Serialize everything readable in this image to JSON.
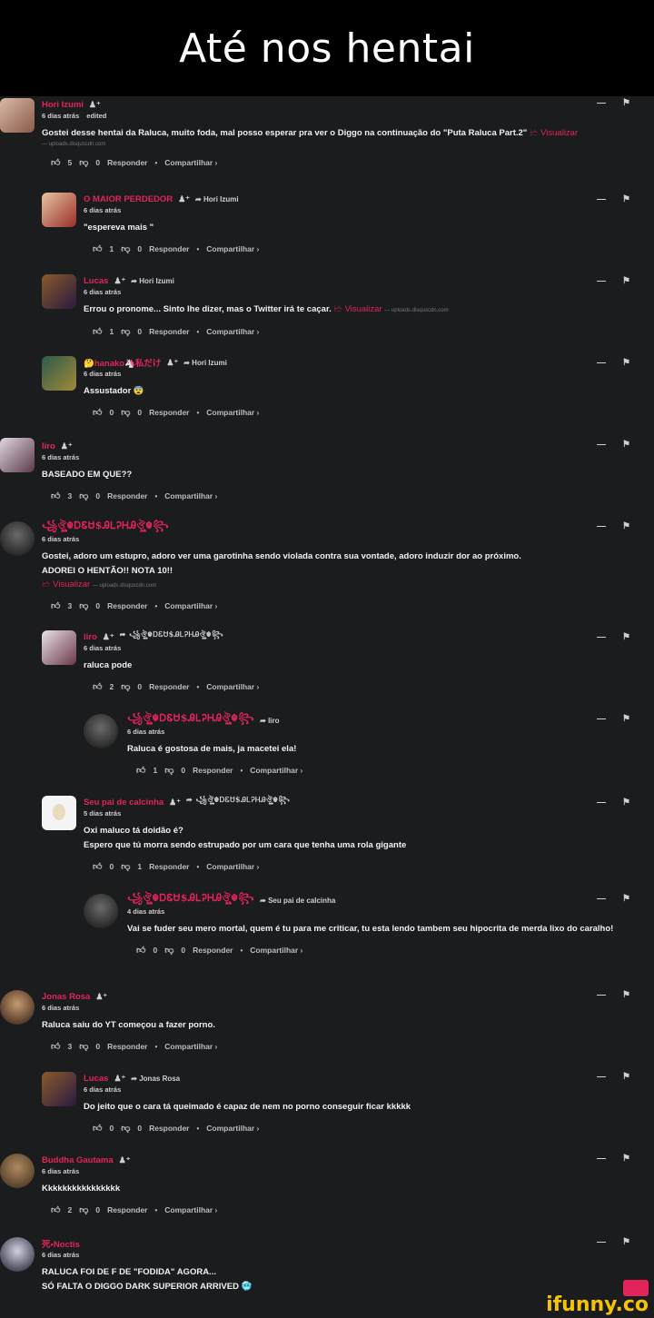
{
  "page": {
    "title": "Até nos hentai"
  },
  "thread": {
    "c1": {
      "author": "Hori Izumi",
      "badge": "♟⁺",
      "time": "6 dias atrás",
      "edited": "edited",
      "text": "Gostei desse hentai da Raluca, muito foda, mal posso esperar pra ver o Diggo na continuação do \"Puta Raluca Part.2\"",
      "visualizar": "🗠 Visualizar",
      "source": "— uploads.disquscdn.com",
      "likes": "5",
      "dislikes": "0",
      "reply": "Responder",
      "share": "Compartilhar ›"
    },
    "c2": {
      "author": "O MAIOR PERDEDOR",
      "badge": "♟⁺",
      "reply_to": "➦ Hori Izumi",
      "time": "6 dias atrás",
      "text": "\"espereva mais \"",
      "likes": "1",
      "dislikes": "0",
      "reply": "Responder",
      "share": "Compartilhar ›"
    },
    "c3": {
      "author": "Lucas",
      "badge": "♟⁺",
      "reply_to": "➦ Hori Izumi",
      "time": "6 dias atrás",
      "text": "Errou o pronome... Sinto lhe dizer, mas o Twitter irá te caçar.",
      "visualizar": "🗠 Visualizar",
      "source": "— uploads.disquscdn.com",
      "likes": "1",
      "dislikes": "0",
      "reply": "Responder",
      "share": "Compartilhar ›"
    },
    "c4": {
      "author": "🤔hanako🦄私だけ",
      "badge": "♟⁺",
      "reply_to": "➦ Hori Izumi",
      "time": "6 dias atrás",
      "text": "Assustador 😨",
      "likes": "0",
      "dislikes": "0",
      "reply": "Responder",
      "share": "Compartilhar ›"
    },
    "c5": {
      "author": "liro",
      "badge": "♟⁺",
      "time": "6 dias atrás",
      "text": "BASEADO EM QUE??",
      "likes": "3",
      "dislikes": "0",
      "reply": "Responder",
      "share": "Compartilhar ›"
    },
    "c6": {
      "author": "꧁ঔৣ☬ᎠᏋᏌ$ᎯᏞᎮᎻᎯঔৣ☬꧂",
      "time": "6 dias atrás",
      "text1": "Gostei, adoro um estupro, adoro ver uma garotinha sendo violada contra sua vontade, adoro induzir dor ao próximo.",
      "text2": "ADOREI O HENTÃO!! NOTA 10!!",
      "visualizar": "🗠 Visualizar",
      "source": "— uploads.disquscdn.com",
      "likes": "3",
      "dislikes": "0",
      "reply": "Responder",
      "share": "Compartilhar ›"
    },
    "c7": {
      "author": "liro",
      "badge": "♟⁺",
      "reply_to": "➦ ꧁ঔৣ☬ᎠᏋᏌ$ᎯᏞᎮᎻᎯঔৣ☬꧂",
      "time": "6 dias atrás",
      "text": "raluca pode",
      "likes": "2",
      "dislikes": "0",
      "reply": "Responder",
      "share": "Compartilhar ›"
    },
    "c8": {
      "author": "꧁ঔৣ☬ᎠᏋᏌ$ᎯᏞᎮᎻᎯঔৣ☬꧂",
      "reply_to": "➦ liro",
      "time": "6 dias atrás",
      "text": "Raluca é gostosa de mais, ja macetei ela!",
      "likes": "1",
      "dislikes": "0",
      "reply": "Responder",
      "share": "Compartilhar ›"
    },
    "c9": {
      "author": "Seu pai de calcinha",
      "badge": "♟⁺",
      "reply_to": "➦ ꧁ঔৣ☬ᎠᏋᏌ$ᎯᏞᎮᎻᎯঔৣ☬꧂",
      "time": "5 dias atrás",
      "text1": "Oxi maluco tá doidão é?",
      "text2": "Espero que tú morra sendo estrupado por um cara que tenha uma rola gigante",
      "likes": "0",
      "dislikes": "1",
      "reply": "Responder",
      "share": "Compartilhar ›"
    },
    "c10": {
      "author": "꧁ঔৣ☬ᎠᏋᏌ$ᎯᏞᎮᎻᎯঔৣ☬꧂",
      "reply_to": "➦ Seu pai de calcinha",
      "time": "4 dias atrás",
      "text": "Vai se fuder seu mero mortal, quem é tu para me criticar, tu esta lendo tambem seu hipocrita de merda lixo do caralho!",
      "likes": "0",
      "dislikes": "0",
      "reply": "Responder",
      "share": "Compartilhar ›"
    },
    "c11": {
      "author": "Jonas Rosa",
      "badge": "♟⁺",
      "time": "6 dias atrás",
      "text": "Raluca saiu do YT começou a fazer porno.",
      "likes": "3",
      "dislikes": "0",
      "reply": "Responder",
      "share": "Compartilhar ›"
    },
    "c12": {
      "author": "Lucas",
      "badge": "♟⁺",
      "reply_to": "➦ Jonas Rosa",
      "time": "6 dias atrás",
      "text": "Do jeito que o cara tá queimado é capaz de nem no porno conseguir ficar kkkkk",
      "likes": "0",
      "dislikes": "0",
      "reply": "Responder",
      "share": "Compartilhar ›"
    },
    "c13": {
      "author": "Buddha Gautama",
      "badge": "♟⁺",
      "time": "6 dias atrás",
      "text": "Kkkkkkkkkkkkkkkk",
      "likes": "2",
      "dislikes": "0",
      "reply": "Responder",
      "share": "Compartilhar ›"
    },
    "c14": {
      "author": "死•Noctis",
      "time": "6 dias atrás",
      "text1": "RALUCA FOI DE F DE \"FODIDA\" AGORA...",
      "text2": "SÓ FALTA O DIGGO DARK SUPERIOR ARRIVED 🥶",
      "likes": "",
      "dislikes": "",
      "reply": "",
      "share": ""
    }
  },
  "controls": {
    "collapse": "—",
    "flag": "⚑"
  },
  "watermark": "ifunny.co",
  "colors": {
    "accent": "#e2245a",
    "background": "#1b1c1e",
    "header": "#000000"
  }
}
